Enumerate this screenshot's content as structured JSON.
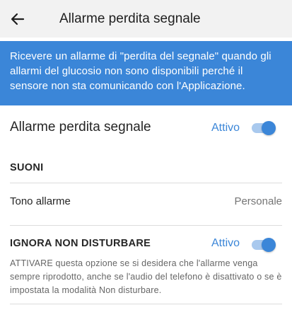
{
  "appbar": {
    "title": "Allarme perdita segnale",
    "back_icon": "arrow-left-icon"
  },
  "banner": {
    "text": "Ricevere un allarme di \"perdita del segnale\" quando gli allarmi del glucosio non sono disponibili perché il sensore non sta comunicando con l'Applicazione.",
    "color": "#3b86d8"
  },
  "signal_loss_alarm": {
    "label": "Allarme perdita segnale",
    "status": "Attivo",
    "enabled": true
  },
  "sounds_section": {
    "header": "SUONI",
    "alarm_tone": {
      "label": "Tono allarme",
      "value": "Personale"
    }
  },
  "dnd_override": {
    "header": "IGNORA NON DISTURBARE",
    "status": "Attivo",
    "enabled": true,
    "description": "ATTIVARE questa opzione se si desidera che l'allarme venga sempre riprodotto, anche se l'audio del telefono è disattivato o se è impostata la modalità Non disturbare."
  },
  "colors": {
    "accent": "#3b86d8",
    "appbar_bg": "#f2f2f2"
  }
}
